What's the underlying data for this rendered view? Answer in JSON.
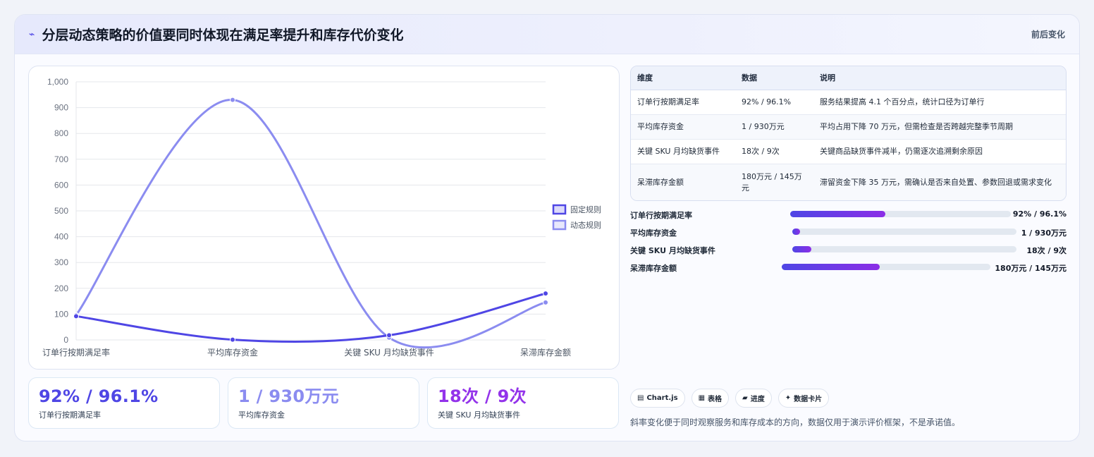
{
  "header": {
    "title": "分层动态策略的价值要同时体现在满足率提升和库存代价变化",
    "right": "前后变化",
    "icon": "sparkle-icon"
  },
  "chart_data": {
    "type": "line",
    "categories": [
      "订单行按期满足率",
      "平均库存资金",
      "关键 SKU 月均缺货事件",
      "呆滞库存金额"
    ],
    "series": [
      {
        "name": "固定规则",
        "values": [
          92,
          1,
          18,
          180
        ],
        "color": "#4f46e5"
      },
      {
        "name": "动态规则",
        "values": [
          96.1,
          930,
          9,
          145
        ],
        "color": "#8b8cf0"
      }
    ],
    "yticks": [
      "0",
      "100",
      "200",
      "300",
      "400",
      "500",
      "600",
      "700",
      "800",
      "900",
      "1,000"
    ],
    "ylim": [
      0,
      1000
    ],
    "grid": true,
    "legend": "right"
  },
  "kpis": [
    {
      "value": "92% / 96.1%",
      "label": "订单行按期满足率",
      "color": "#4f46e5"
    },
    {
      "value": "1 / 930万元",
      "label": "平均库存资金",
      "color": "#8b8cf0"
    },
    {
      "value": "18次 / 9次",
      "label": "关键 SKU 月均缺货事件",
      "color": "#9333ea"
    }
  ],
  "table": {
    "headers": [
      "维度",
      "数据",
      "说明"
    ],
    "rows": [
      [
        "订单行按期满足率",
        "92% / 96.1%",
        "服务结果提高 4.1 个百分点，统计口径为订单行"
      ],
      [
        "平均库存资金",
        "1 / 930万元",
        "平均占用下降 70 万元，但需检查是否跨越完整季节周期"
      ],
      [
        "关键 SKU 月均缺货事件",
        "18次 / 9次",
        "关键商品缺货事件减半，仍需逐次追溯剩余原因"
      ],
      [
        "呆滞库存金额",
        "180万元 / 145万元",
        "滞留资金下降 35 万元，需确认是否来自处置、参数回退或需求变化"
      ]
    ]
  },
  "progress": [
    {
      "label": "订单行按期满足率",
      "value": "92% / 96.1%",
      "fill": 0.43
    },
    {
      "label": "平均库存资金",
      "value": "1 / 930万元",
      "fill": 0.035
    },
    {
      "label": "关键 SKU 月均缺货事件",
      "value": "18次 / 9次",
      "fill": 0.085
    },
    {
      "label": "呆滞库存金额",
      "value": "180万元 / 145万元",
      "fill": 0.47
    }
  ],
  "tags": [
    {
      "icon": "chart-icon",
      "glyph": "▤",
      "label": "Chart.js"
    },
    {
      "icon": "table-icon",
      "glyph": "▦",
      "label": "表格"
    },
    {
      "icon": "progress-icon",
      "glyph": "▰",
      "label": "进度"
    },
    {
      "icon": "card-icon",
      "glyph": "✦",
      "label": "数据卡片"
    }
  ],
  "note": "斜率变化便于同时观察服务和库存成本的方向，数据仅用于演示评价框架，不是承诺值。"
}
